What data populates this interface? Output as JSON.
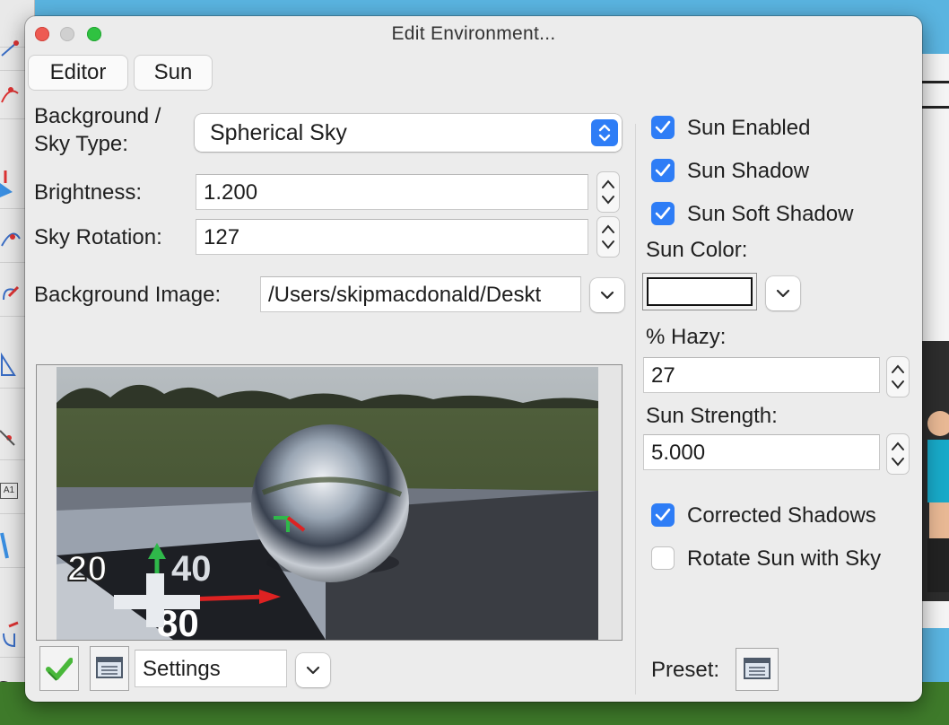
{
  "dialog": {
    "title": "Edit Environment...",
    "tabs": [
      {
        "label": "Editor",
        "selected": true
      },
      {
        "label": "Sun",
        "selected": false
      }
    ]
  },
  "editor": {
    "sky_type": {
      "label_line1": "Background /",
      "label_line2": "Sky Type:",
      "value": "Spherical Sky"
    },
    "brightness": {
      "label": "Brightness:",
      "value": "1.200"
    },
    "sky_rotation": {
      "label": "Sky Rotation:",
      "value": "127"
    },
    "background_image": {
      "label": "Background Image:",
      "value": "/Users/skipmacdonald/Deskt"
    },
    "settings_select": {
      "value": "Settings"
    }
  },
  "sun": {
    "sun_enabled": {
      "label": "Sun Enabled",
      "checked": true
    },
    "sun_shadow": {
      "label": "Sun Shadow",
      "checked": true
    },
    "sun_soft_shadow": {
      "label": "Sun Soft Shadow",
      "checked": true
    },
    "sun_color": {
      "label": "Sun Color:",
      "value": "#ffffff"
    },
    "hazy": {
      "label": "% Hazy:",
      "value": "27"
    },
    "sun_strength": {
      "label": "Sun Strength:",
      "value": "5.000"
    },
    "corrected_shadows": {
      "label": "Corrected Shadows",
      "checked": true
    },
    "rotate_sun_with_sky": {
      "label": "Rotate Sun with Sky",
      "checked": false
    },
    "preset_label": "Preset:"
  },
  "preview": {
    "floor_numbers": [
      "20",
      "40",
      "80"
    ]
  },
  "icons": {
    "close": "close-icon",
    "minimize": "minimize-icon",
    "zoom": "zoom-icon",
    "popup": "popup-arrows-icon",
    "dropdown": "chevron-down-icon",
    "stepper": "stepper-arrows-icon",
    "checkmark": "checkmark-icon",
    "list": "list-icon"
  },
  "colors": {
    "accent": "#2e7df6",
    "close": "#ee5a52",
    "minimize": "#d0d0d0",
    "zoom": "#2fc241",
    "ok_check": "#49b83a"
  }
}
